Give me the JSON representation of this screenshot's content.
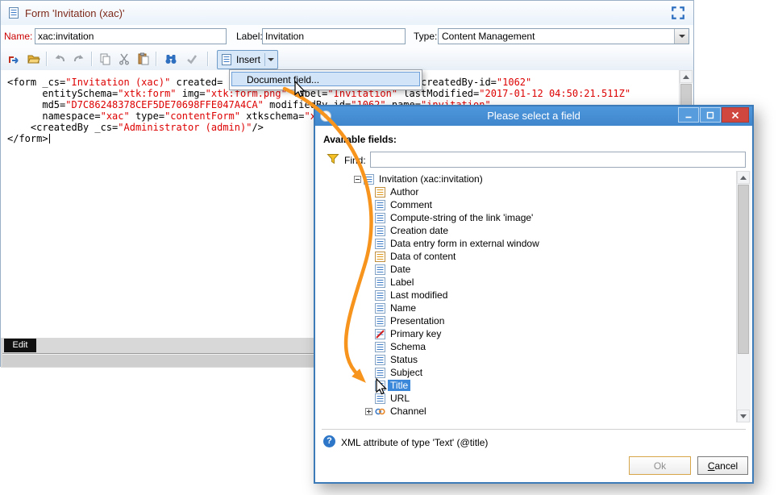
{
  "main_window": {
    "title": "Form 'Invitation (xac)'",
    "fields": {
      "name_label": "Name:",
      "name_value": "xac:invitation",
      "label_label": "Label:",
      "label_value": "Invitation",
      "type_label": "Type:",
      "type_value": "Content Management"
    },
    "toolbar": {
      "insert_label": "Insert"
    },
    "menu_items": [
      {
        "label": "Document field..."
      }
    ],
    "editor_lines": [
      {
        "segments": [
          {
            "t": "<form _cs=",
            "c": "k"
          },
          {
            "t": "\"Invitation (xac)\"",
            "c": "v"
          },
          {
            "t": " created=",
            "c": "k"
          },
          {
            "t": "                                  ",
            "c": "k"
          },
          {
            "t": "createdBy-id=",
            "c": "k"
          },
          {
            "t": "\"1062\"",
            "c": "v"
          }
        ]
      },
      {
        "segments": [
          {
            "t": "      entitySchema=",
            "c": "k"
          },
          {
            "t": "\"xtk:form\"",
            "c": "v"
          },
          {
            "t": " img=",
            "c": "k"
          },
          {
            "t": "\"xtk:form.png\"",
            "c": "v"
          },
          {
            "t": " label=",
            "c": "k"
          },
          {
            "t": "\"Invitation\"",
            "c": "v"
          },
          {
            "t": " lastModified=",
            "c": "k"
          },
          {
            "t": "\"2017-01-12 04:50:21.511Z\"",
            "c": "v"
          }
        ]
      },
      {
        "segments": [
          {
            "t": "      md5=",
            "c": "k"
          },
          {
            "t": "\"D7C86248378CEF5DE70698FFE047A4CA\"",
            "c": "v"
          },
          {
            "t": " modifiedBy-id=",
            "c": "k"
          },
          {
            "t": "\"1062\"",
            "c": "v"
          },
          {
            "t": " name=",
            "c": "k"
          },
          {
            "t": "\"invitation\"",
            "c": "v"
          }
        ]
      },
      {
        "segments": [
          {
            "t": "      namespace=",
            "c": "k"
          },
          {
            "t": "\"xac\"",
            "c": "v"
          },
          {
            "t": " type=",
            "c": "k"
          },
          {
            "t": "\"contentForm\"",
            "c": "v"
          },
          {
            "t": " xtkschema=",
            "c": "k"
          },
          {
            "t": "\"xtk:form\"",
            "c": "v"
          },
          {
            "t": ">",
            "c": "k"
          }
        ]
      },
      {
        "segments": [
          {
            "t": "    <createdBy _cs=",
            "c": "k"
          },
          {
            "t": "\"Administrator (admin)\"",
            "c": "v"
          },
          {
            "t": "/>",
            "c": "k"
          }
        ]
      },
      {
        "segments": [
          {
            "t": "</form>",
            "c": "k"
          }
        ],
        "caret": true
      }
    ],
    "edit_tab": "Edit"
  },
  "dialog": {
    "title": "Please select a field",
    "available_fields_label": "Available fields:",
    "find_label": "Find:",
    "find_value": "",
    "tree": {
      "root": {
        "label": "Invitation (xac:invitation)",
        "icon": "list-blue",
        "expander": "minus"
      },
      "items": [
        {
          "label": "Author",
          "icon": "list-yellow"
        },
        {
          "label": "Comment",
          "icon": "list-blue"
        },
        {
          "label": "Compute-string of the link 'image'",
          "icon": "list-blue"
        },
        {
          "label": "Creation date",
          "icon": "list-blue"
        },
        {
          "label": "Data entry form in external window",
          "icon": "list-blue"
        },
        {
          "label": "Data of content",
          "icon": "list-yellow"
        },
        {
          "label": "Date",
          "icon": "list-blue"
        },
        {
          "label": "Label",
          "icon": "list-blue"
        },
        {
          "label": "Last modified",
          "icon": "list-blue"
        },
        {
          "label": "Name",
          "icon": "list-blue"
        },
        {
          "label": "Presentation",
          "icon": "list-blue"
        },
        {
          "label": "Primary key",
          "icon": "key"
        },
        {
          "label": "Schema",
          "icon": "list-blue"
        },
        {
          "label": "Status",
          "icon": "list-blue"
        },
        {
          "label": "Subject",
          "icon": "list-blue"
        },
        {
          "label": "Title",
          "icon": "list-blue",
          "selected": true
        },
        {
          "label": "URL",
          "icon": "list-blue"
        },
        {
          "label": "Channel",
          "icon": "link",
          "expander": "plus"
        }
      ]
    },
    "help_glyph": "?",
    "help_text": "XML attribute of type 'Text' (@title)",
    "ok_label": "Ok",
    "cancel_label": "Cancel"
  },
  "colors": {
    "annotation_arrow": "#F7941D",
    "xml_value_red": "#DD0000",
    "selection_blue": "#3B87D9",
    "dialog_title_blue": "#4590D6",
    "close_button_red": "#D04740"
  }
}
